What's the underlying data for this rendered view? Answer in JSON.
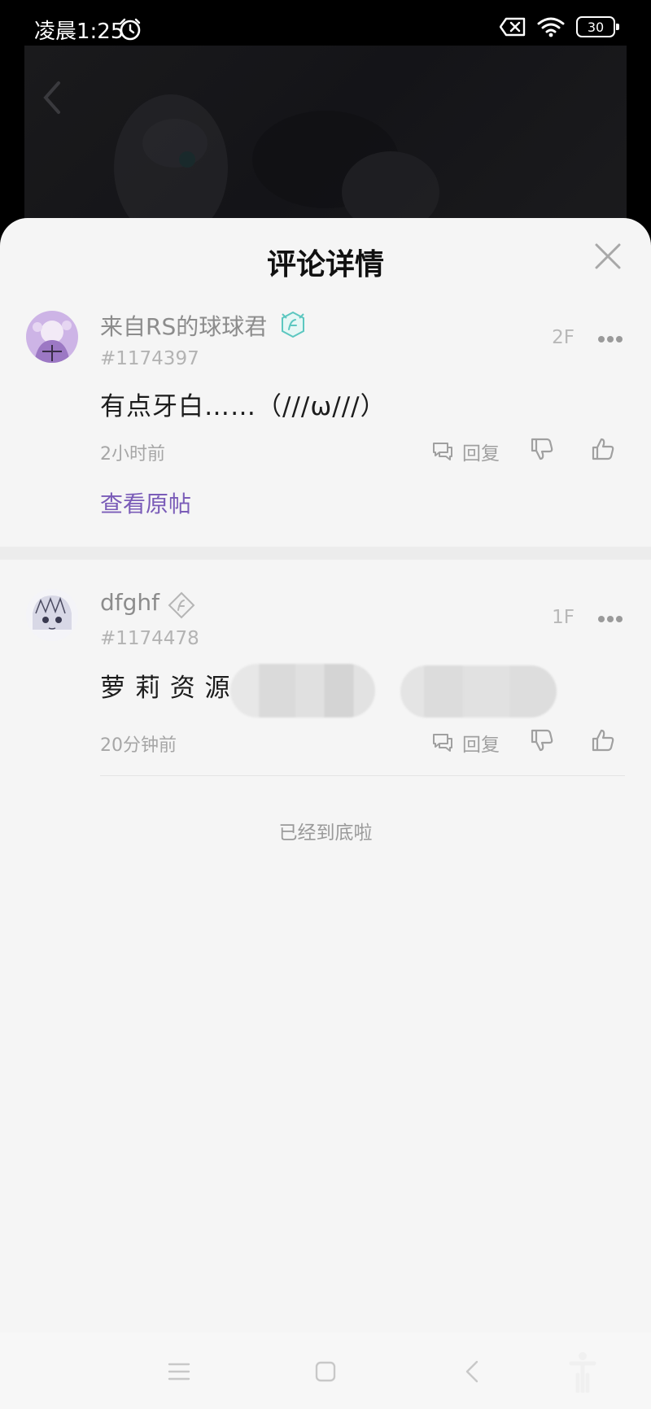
{
  "status_bar": {
    "time": "凌晨1:25",
    "battery": "30",
    "icons": [
      "alarm-icon",
      "no-sim-icon",
      "wifi-icon",
      "battery-icon"
    ]
  },
  "sheet": {
    "title": "评论详情"
  },
  "comments": [
    {
      "username": "来自RS的球球君",
      "user_id": "#1174397",
      "floor": "2F",
      "text": "有点牙白……（///ω///）",
      "time": "2小时前",
      "reply_label": "回复",
      "view_post_label": "查看原帖",
      "badge_color": "#5cc7c0"
    },
    {
      "username": "dfghf",
      "user_id": "#1174478",
      "floor": "1F",
      "text": "萝 莉 资 源",
      "time": "20分钟前",
      "reply_label": "回复",
      "badge_color": "#b5b5b5"
    }
  ],
  "end_text": "已经到底啦",
  "colors": {
    "link": "#7a5cb8",
    "sheet_bg": "#f5f5f5"
  }
}
